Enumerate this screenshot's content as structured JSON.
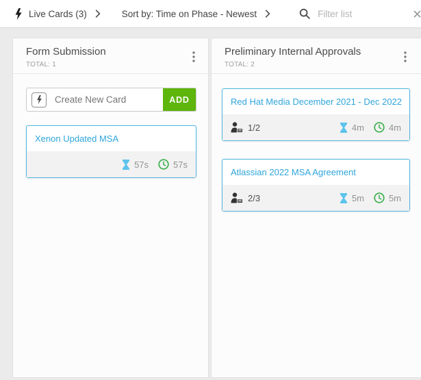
{
  "topbar": {
    "live_cards": {
      "label": "Live Cards (3)"
    },
    "sort": {
      "label": "Sort by: Time on Phase - Newest"
    },
    "filter": {
      "placeholder": "Filter list"
    }
  },
  "board": {
    "columns": [
      {
        "title": "Form Submission",
        "total": "TOTAL: 1",
        "create_card": {
          "placeholder": "Create New Card",
          "add_label": "ADD"
        },
        "cards": [
          {
            "title": "Xenon Updated MSA",
            "time_on_phase": "57s",
            "total_time": "57s"
          }
        ]
      },
      {
        "title": "Preliminary Internal Approvals",
        "total": "TOTAL: 2",
        "cards": [
          {
            "title": "Red Hat Media December 2021 - Dec 2022",
            "assignees": "1/2",
            "time_on_phase": "4m",
            "total_time": "4m"
          },
          {
            "title": "Atlassian 2022 MSA Agreement",
            "assignees": "2/3",
            "time_on_phase": "5m",
            "total_time": "5m"
          }
        ]
      }
    ]
  },
  "icons": {
    "bolt": "lightning-bolt",
    "hourglass": "time-on-phase",
    "clock": "total-time",
    "person_badge": "assignees"
  },
  "colors": {
    "accent_blue": "#2fa5da",
    "card_border_blue": "#4db5dd",
    "add_button_green": "#5eb50c",
    "clock_green": "#3bae4c",
    "hourglass_blue": "#5ec4ec",
    "footer_gray": "#f2f2f2"
  }
}
